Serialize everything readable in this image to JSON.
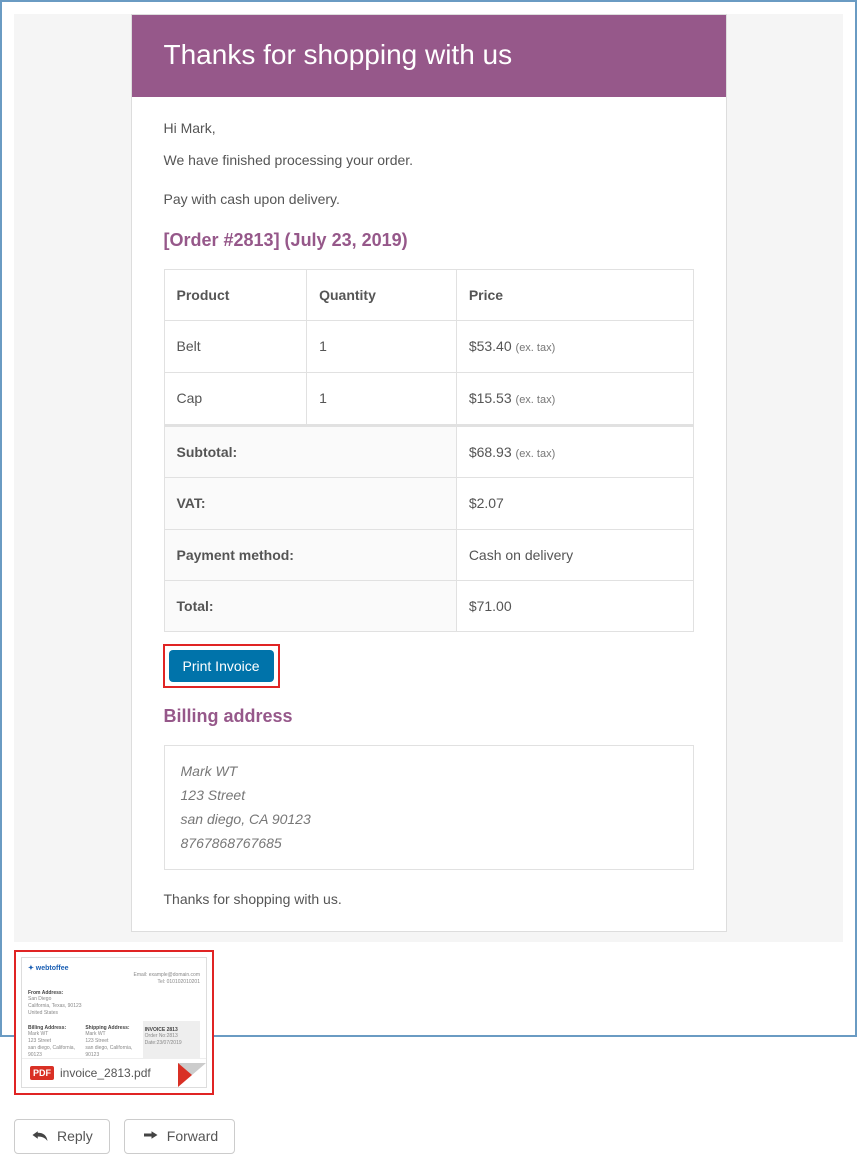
{
  "header": {
    "title": "Thanks for shopping with us"
  },
  "body": {
    "greeting": "Hi Mark,",
    "processed_line": "We have finished processing your order.",
    "pay_line": "Pay with cash upon delivery.",
    "order_heading": "[Order #2813] (July 23, 2019)",
    "table": {
      "headers": {
        "product": "Product",
        "quantity": "Quantity",
        "price": "Price"
      },
      "items": [
        {
          "product": "Belt",
          "quantity": "1",
          "price": "$53.40",
          "suffix": "(ex. tax)"
        },
        {
          "product": "Cap",
          "quantity": "1",
          "price": "$15.53",
          "suffix": "(ex. tax)"
        }
      ],
      "totals": [
        {
          "label": "Subtotal:",
          "value": "$68.93",
          "suffix": "(ex. tax)"
        },
        {
          "label": "VAT:",
          "value": "$2.07",
          "suffix": ""
        },
        {
          "label": "Payment method:",
          "value": "Cash on delivery",
          "suffix": ""
        },
        {
          "label": "Total:",
          "value": "$71.00",
          "suffix": ""
        }
      ]
    },
    "print_button": "Print Invoice",
    "billing_heading": "Billing address",
    "billing": {
      "name": "Mark WT",
      "street": "123 Street",
      "city_line": "san diego, CA 90123",
      "phone": "8767868767685"
    },
    "footer_line": "Thanks for shopping with us."
  },
  "attachment": {
    "filename": "invoice_2813.pdf",
    "badge": "PDF"
  },
  "actions": {
    "reply": "Reply",
    "forward": "Forward"
  }
}
